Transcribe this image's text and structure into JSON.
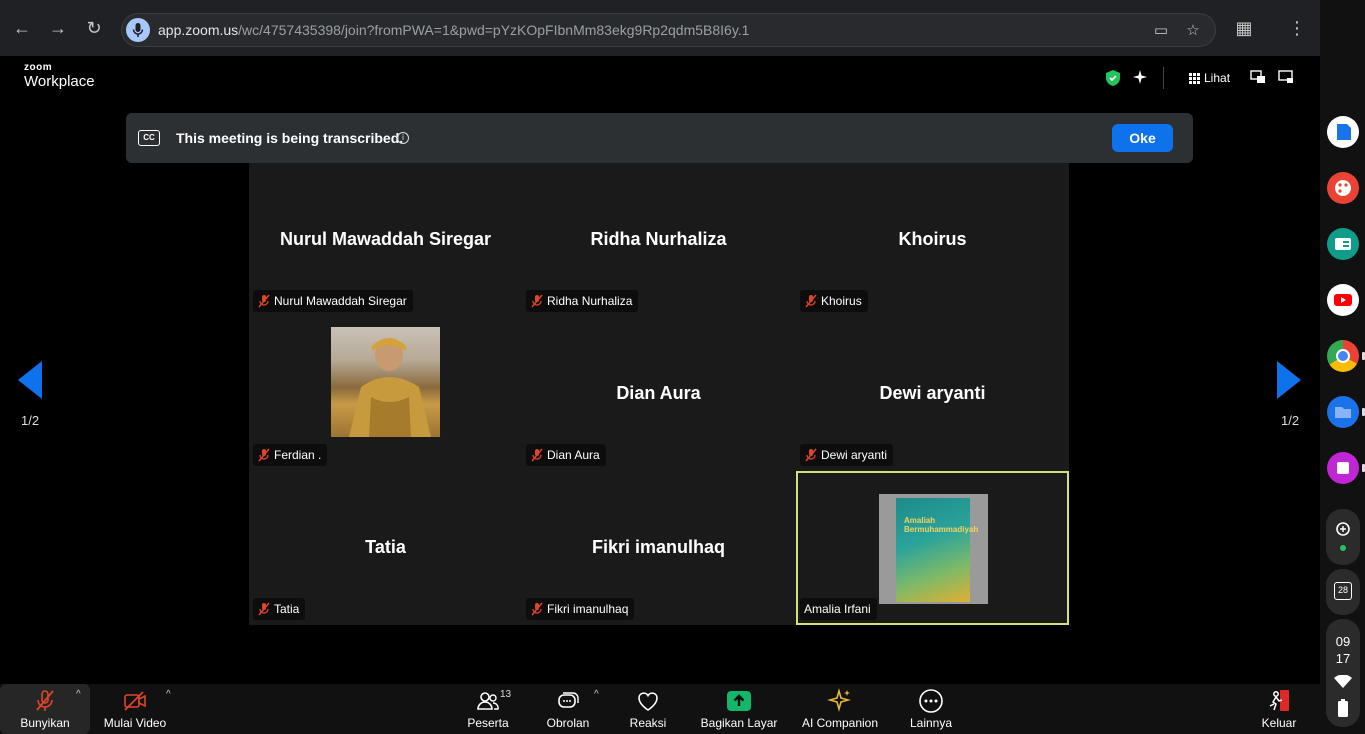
{
  "browser": {
    "url_host": "app.zoom.us",
    "url_path": "/wc/4757435398/join?fromPWA=1&pwd=pYzKOpFIbnMm83ekg9Rp2qdm5B8I6y.1"
  },
  "header": {
    "logo_small": "zoom",
    "logo_big": "Workplace",
    "view_label": "Lihat"
  },
  "banner": {
    "text": "This meeting is being transcribed.",
    "cc_label": "CC",
    "ok_label": "Oke"
  },
  "pagination": {
    "left": "1/2",
    "right": "1/2"
  },
  "participants": [
    {
      "name": "Nurul Mawaddah Siregar",
      "label": "Nurul Mawaddah Siregar",
      "muted": true,
      "video": false
    },
    {
      "name": "Ridha Nurhaliza",
      "label": "Ridha Nurhaliza",
      "muted": true,
      "video": false
    },
    {
      "name": "Khoirus",
      "label": "Khoirus",
      "muted": true,
      "video": false
    },
    {
      "name": "Ferdian .",
      "label": "Ferdian .",
      "muted": true,
      "video": "photo"
    },
    {
      "name": "Dian Aura",
      "label": "Dian Aura",
      "muted": true,
      "video": false
    },
    {
      "name": "Dewi aryanti",
      "label": "Dewi aryanti",
      "muted": true,
      "video": false
    },
    {
      "name": "Tatia",
      "label": "Tatia",
      "muted": true,
      "video": false
    },
    {
      "name": "Fikri imanulhaq",
      "label": "Fikri imanulhaq",
      "muted": true,
      "video": false
    },
    {
      "name": "Amalia Irfani",
      "label": "Amalia Irfani",
      "muted": false,
      "video": "book",
      "active_speaker": true
    }
  ],
  "book": {
    "title_line1": "Amaliah",
    "title_line2": "Bermuhammadiyah"
  },
  "toolbar": {
    "unmute": "Bunyikan",
    "start_video": "Mulai Video",
    "participants": "Peserta",
    "participants_count": "13",
    "chat": "Obrolan",
    "reactions": "Reaksi",
    "share": "Bagikan Layar",
    "ai": "AI Companion",
    "more": "Lainnya",
    "leave": "Keluar"
  },
  "shelf": {
    "calendar_day": "28",
    "clock_hour": "09",
    "clock_min": "17"
  },
  "colors": {
    "accent": "#0e72ed",
    "active_border": "#cfe37a",
    "share_green": "#12b76a",
    "leave_red": "#e02828",
    "mute_red": "#e0442b"
  }
}
